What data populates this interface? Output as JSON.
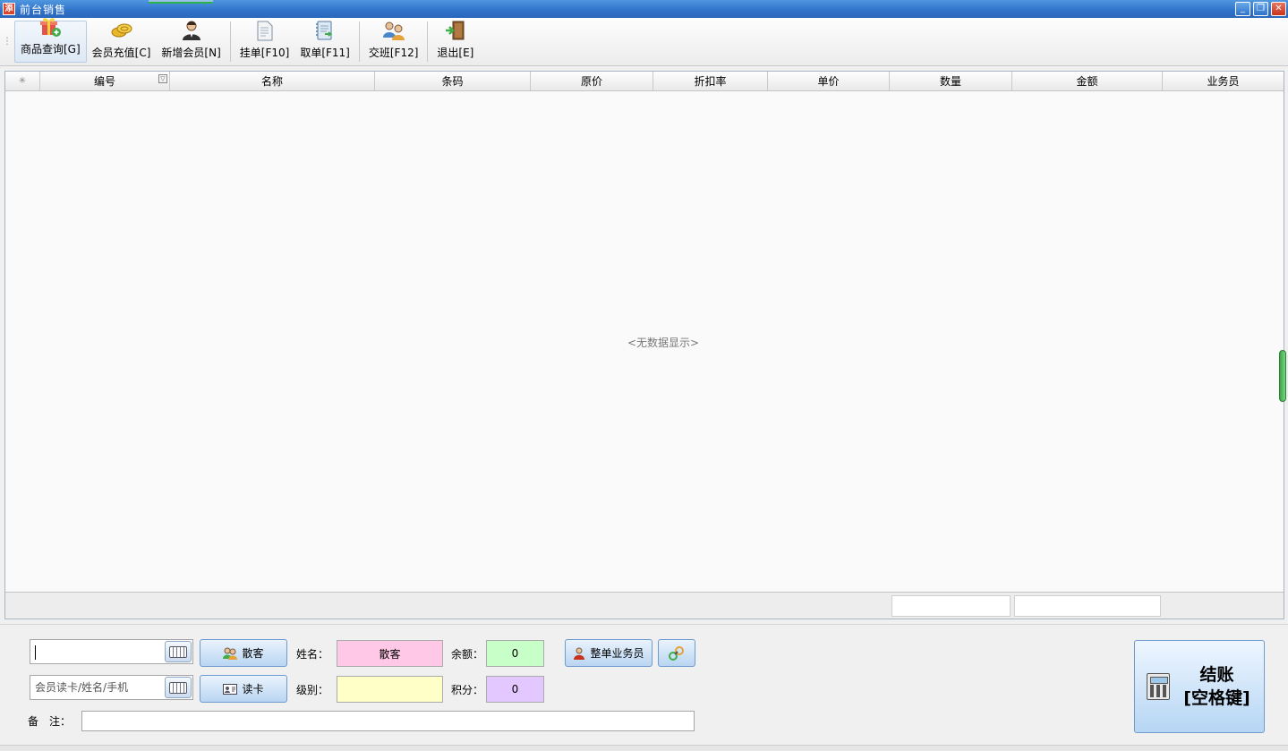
{
  "window": {
    "title": "前台销售",
    "app_icon_glyph": "添",
    "controls": {
      "minimize": "_",
      "restore": "❐",
      "close": "✕"
    }
  },
  "toolbar": {
    "items": [
      {
        "label": "商品查询[G]",
        "icon": "gift-box-icon"
      },
      {
        "label": "会员充值[C]",
        "icon": "coins-icon"
      },
      {
        "label": "新增会员[N]",
        "icon": "person-icon"
      },
      {
        "label": "挂单[F10]",
        "icon": "document-icon"
      },
      {
        "label": "取单[F11]",
        "icon": "notebook-icon"
      },
      {
        "label": "交班[F12]",
        "icon": "users-exchange-icon"
      },
      {
        "label": "退出[E]",
        "icon": "exit-door-icon"
      }
    ]
  },
  "grid": {
    "columns": [
      "编号",
      "名称",
      "条码",
      "原价",
      "折扣率",
      "单价",
      "数量",
      "金额",
      "业务员"
    ],
    "empty_text": "<无数据显示>"
  },
  "panel": {
    "input1_value": "",
    "member_search_placeholder": "会员读卡/姓名/手机",
    "walkin_button": "散客",
    "read_card_button": "读卡",
    "name_label": "姓名：",
    "name_value": "散客",
    "level_label": "级别：",
    "level_value": "",
    "balance_label": "余额：",
    "balance_value": "0",
    "points_label": "积分：",
    "points_value": "0",
    "salesman_button": "整单业务员",
    "remark_label": "备　注：",
    "remark_value": "",
    "checkout_line1": "结账",
    "checkout_line2": "[空格键]"
  },
  "colors": {
    "name_field": "#ffc8e6",
    "level_field": "#ffffc8",
    "balance_field": "#c8ffc8",
    "points_field": "#e2c8ff"
  }
}
